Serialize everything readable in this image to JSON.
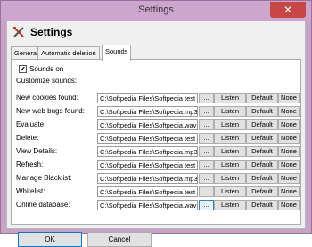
{
  "window": {
    "title": "Settings",
    "close_glyph": "✕"
  },
  "header": {
    "title": "Settings",
    "icon": "tools-icon"
  },
  "tabs": [
    {
      "label": "General"
    },
    {
      "label": "Automatic deletion"
    },
    {
      "label": "Sounds"
    }
  ],
  "sounds": {
    "sounds_on_label": "Sounds on",
    "sounds_on_checked": true,
    "check_glyph": "✔",
    "customize_label": "Customize sounds:",
    "rows": [
      {
        "label": "New cookies found:",
        "path": "C:\\Softpedia Files\\Softpedia test"
      },
      {
        "label": "New web bugs found:",
        "path": "C:\\Softpedia Files\\Softpedia.mp3"
      },
      {
        "label": "Evaluate:",
        "path": "C:\\Softpedia Files\\Softpedia.wav"
      },
      {
        "label": "Delete:",
        "path": "C:\\Softpedia Files\\Softpedia test"
      },
      {
        "label": "View Details:",
        "path": "C:\\Softpedia Files\\Softpedia.mp3"
      },
      {
        "label": "Refresh:",
        "path": "C:\\Softpedia Files\\Softpedia test"
      },
      {
        "label": "Manage Blacklist:",
        "path": "C:\\Softpedia Files\\Softpedia.mp3"
      },
      {
        "label": "Whitelist:",
        "path": "C:\\Softpedia Files\\Softpedia test"
      },
      {
        "label": "Online database:",
        "path": "C:\\Softpedia Files\\Softpedia.wav"
      }
    ],
    "browse_label": "...",
    "listen_label": "Listen",
    "default_label": "Default",
    "none_label": "None"
  },
  "footer": {
    "ok_label": "OK",
    "cancel_label": "Cancel"
  }
}
